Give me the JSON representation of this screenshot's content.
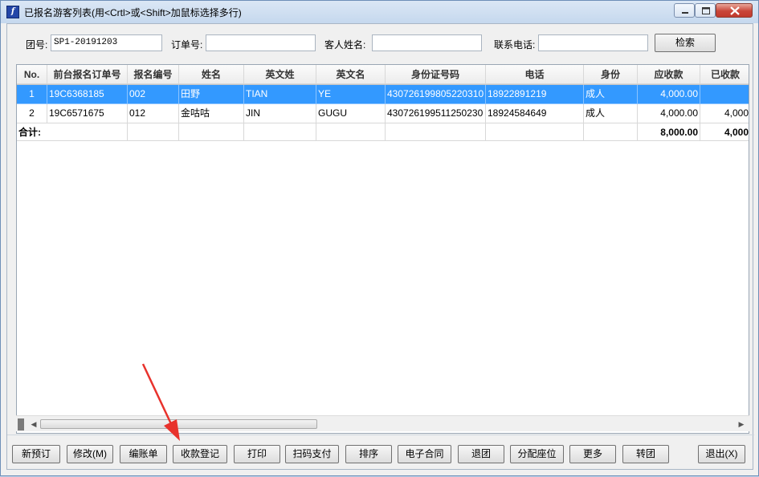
{
  "window": {
    "title": "已报名游客列表(用<Crtl>或<Shift>加鼠标选择多行)",
    "icon": "app-logo-icon"
  },
  "search": {
    "group_label": "团号:",
    "group_value": "SP1-20191203",
    "order_label": "订单号:",
    "order_value": "",
    "guest_label": "客人姓名:",
    "guest_value": "",
    "phone_label": "联系电话:",
    "phone_value": "",
    "search_button": "检索"
  },
  "table": {
    "headers": [
      "No.",
      "前台报名订单号",
      "报名编号",
      "姓名",
      "英文姓",
      "英文名",
      "身份证号码",
      "电话",
      "身份",
      "应收款",
      "已收款"
    ],
    "rows": [
      {
        "no": "1",
        "order": "19C6368185",
        "bm": "002",
        "name": "田野",
        "en1": "TIAN",
        "en2": "YE",
        "id": "430726199805220310",
        "tel": "18922891219",
        "sf": "成人",
        "ys": "4,000.00",
        "yi": "",
        "selected": true
      },
      {
        "no": "2",
        "order": "19C6571675",
        "bm": "012",
        "name": "金咕咕",
        "en1": "JIN",
        "en2": "GUGU",
        "id": "430726199511250230",
        "tel": "18924584649",
        "sf": "成人",
        "ys": "4,000.00",
        "yi": "4,000",
        "selected": false
      }
    ],
    "total": {
      "label": "合计:",
      "ys": "8,000.00",
      "yi": "4,000"
    }
  },
  "toolbar": {
    "new": "新预订",
    "edit": "修改(M)",
    "bill": "编账单",
    "receipt": "收款登记",
    "print": "打印",
    "scanpay": "扫码支付",
    "sort": "排序",
    "contract": "电子合同",
    "quit_group": "退团",
    "seat": "分配座位",
    "more": "更多",
    "transfer": "转团",
    "exit": "退出(X)"
  },
  "colors": {
    "selection": "#3399ff",
    "annotation_arrow": "#e8322c"
  }
}
